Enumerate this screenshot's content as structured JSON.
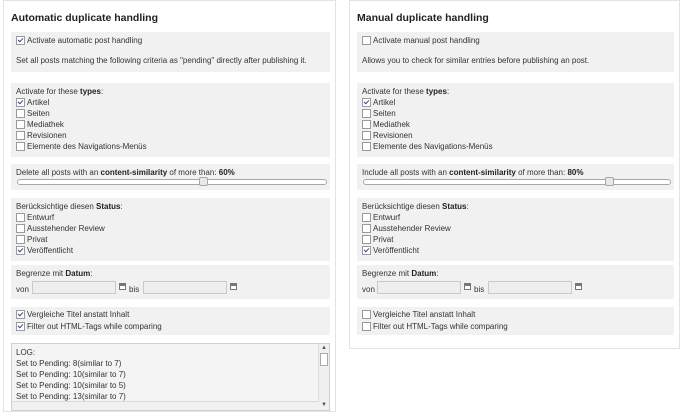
{
  "auto": {
    "title": "Automatic duplicate handling",
    "activate_label": "Activate automatic post handling",
    "activate_checked": true,
    "description": "Set all posts matching the following criteria as \"pending\" directly after publishing it.",
    "types_prefix": "Activate for these ",
    "types_bold": "types",
    "types_suffix": ":",
    "types": [
      {
        "label": "Artikel",
        "checked": true
      },
      {
        "label": "Seiten",
        "checked": false
      },
      {
        "label": "Mediathek",
        "checked": false
      },
      {
        "label": "Revisionen",
        "checked": false
      },
      {
        "label": "Elemente des Navigations-Menüs",
        "checked": false
      }
    ],
    "similarity_prefix": "Delete all posts with an ",
    "similarity_bold": "content-similarity",
    "similarity_mid": " of more than: ",
    "similarity_value": "60%",
    "similarity_level": 60,
    "status_prefix": "Berücksichtige diesen ",
    "status_bold": "Status",
    "status_suffix": ":",
    "status": [
      {
        "label": "Entwurf",
        "checked": false
      },
      {
        "label": "Ausstehender Review",
        "checked": false
      },
      {
        "label": "Privat",
        "checked": false
      },
      {
        "label": "Veröffentlicht",
        "checked": true
      }
    ],
    "date_prefix": "Begrenze mit ",
    "date_bold": "Datum",
    "date_suffix": ":",
    "from_label": "von",
    "to_label": "bis",
    "compare_title": {
      "label": "Vergleiche Titel anstatt Inhalt",
      "checked": true
    },
    "filter_html": {
      "label": "Filter out HTML-Tags while comparing",
      "checked": true
    },
    "log_title": "LOG:",
    "log_lines": [
      "Set to Pending: 8(similar to 7)",
      "Set to Pending: 10(similar to 7)",
      "Set to Pending: 10(similar to 5)",
      "Set to Pending: 13(similar to 7)"
    ]
  },
  "manual": {
    "title": "Manual duplicate handling",
    "activate_label": "Activate manual post handling",
    "activate_checked": false,
    "description": "Allows you to check for similar entries before publishing an post.",
    "types_prefix": "Activate for these ",
    "types_bold": "types",
    "types_suffix": ":",
    "types": [
      {
        "label": "Artikel",
        "checked": true
      },
      {
        "label": "Seiten",
        "checked": false
      },
      {
        "label": "Mediathek",
        "checked": false
      },
      {
        "label": "Revisionen",
        "checked": false
      },
      {
        "label": "Elemente des Navigations-Menüs",
        "checked": false
      }
    ],
    "similarity_prefix": "Include all posts with an ",
    "similarity_bold": "content-similarity",
    "similarity_mid": " of more than: ",
    "similarity_value": "80%",
    "similarity_level": 80,
    "status_prefix": "Berücksichtige diesen ",
    "status_bold": "Status",
    "status_suffix": ":",
    "status": [
      {
        "label": "Entwurf",
        "checked": false
      },
      {
        "label": "Ausstehender Review",
        "checked": false
      },
      {
        "label": "Privat",
        "checked": false
      },
      {
        "label": "Veröffentlicht",
        "checked": true
      }
    ],
    "date_prefix": "Begrenze mit ",
    "date_bold": "Datum",
    "date_suffix": ":",
    "from_label": "von",
    "to_label": "bis",
    "compare_title": {
      "label": "Vergleiche Titel anstatt Inhalt",
      "checked": false
    },
    "filter_html": {
      "label": "Filter out HTML-Tags while comparing",
      "checked": false
    }
  }
}
